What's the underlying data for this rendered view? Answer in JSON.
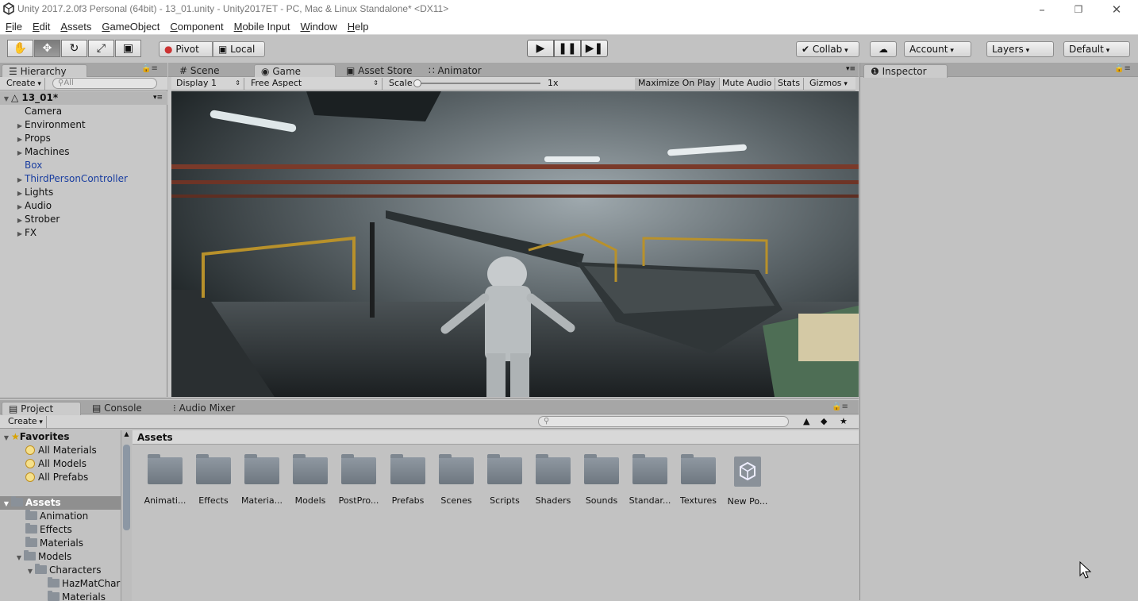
{
  "window": {
    "title": "Unity 2017.2.0f3 Personal (64bit) - 13_01.unity - Unity2017ET - PC, Mac & Linux Standalone* <DX11>"
  },
  "menu": [
    "File",
    "Edit",
    "Assets",
    "GameObject",
    "Component",
    "Mobile Input",
    "Window",
    "Help"
  ],
  "toolbar": {
    "pivot": "Pivot",
    "local": "Local",
    "collab": "Collab",
    "account": "Account",
    "layers": "Layers",
    "layout": "Default"
  },
  "hierarchy": {
    "tab": "Hierarchy",
    "create": "Create",
    "search_placeholder": "All",
    "scene": "13_01*",
    "items": [
      "Camera",
      "Environment",
      "Props",
      "Machines",
      "Box",
      "ThirdPersonController",
      "Lights",
      "Audio",
      "Strober",
      "FX"
    ]
  },
  "viewtabs": {
    "scene": "Scene",
    "game": "Game",
    "asset_store": "Asset Store",
    "animator": "Animator"
  },
  "gamebar": {
    "display": "Display 1",
    "aspect": "Free Aspect",
    "scale_label": "Scale",
    "scale_value": "1x",
    "maximize": "Maximize On Play",
    "mute": "Mute Audio",
    "stats": "Stats",
    "gizmos": "Gizmos"
  },
  "inspector": {
    "tab": "Inspector"
  },
  "bottomtabs": {
    "project": "Project",
    "console": "Console",
    "audio_mixer": "Audio Mixer"
  },
  "project": {
    "create": "Create",
    "favorites_label": "Favorites",
    "favorites": [
      "All Materials",
      "All Models",
      "All Prefabs"
    ],
    "assets_label": "Assets",
    "tree": [
      "Animation",
      "Effects",
      "Materials",
      "Models",
      "Characters",
      "HazMatChar",
      "Materials"
    ],
    "breadcrumb": "Assets",
    "grid": [
      "Animati...",
      "Effects",
      "Materia...",
      "Models",
      "PostPro...",
      "Prefabs",
      "Scenes",
      "Scripts",
      "Shaders",
      "Sounds",
      "Standar...",
      "Textures",
      "New Po..."
    ]
  }
}
